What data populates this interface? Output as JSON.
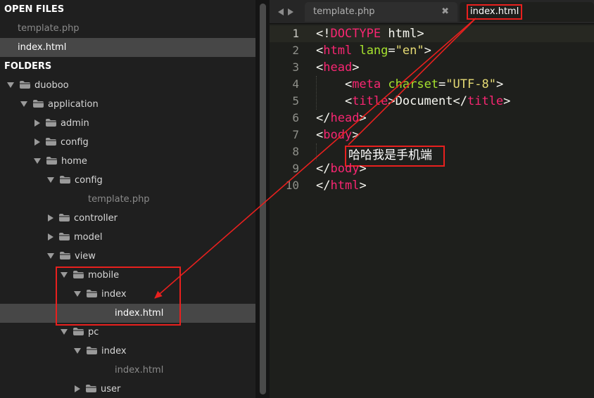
{
  "sidebar": {
    "open_files_header": "OPEN FILES",
    "open_files": [
      {
        "label": "template.php"
      },
      {
        "label": "index.html"
      }
    ],
    "folders_header": "FOLDERS",
    "tree": [
      {
        "label": "duoboo",
        "expanded": "down"
      },
      {
        "label": "application",
        "expanded": "down"
      },
      {
        "label": "admin",
        "expanded": "right"
      },
      {
        "label": "config",
        "expanded": "right"
      },
      {
        "label": "home",
        "expanded": "down"
      },
      {
        "label": "config",
        "expanded": "down"
      },
      {
        "label": "template.php",
        "type": "file"
      },
      {
        "label": "controller",
        "expanded": "right"
      },
      {
        "label": "model",
        "expanded": "right"
      },
      {
        "label": "view",
        "expanded": "down"
      },
      {
        "label": "mobile",
        "expanded": "down"
      },
      {
        "label": "index",
        "expanded": "down"
      },
      {
        "label": "index.html",
        "type": "file",
        "active": true
      },
      {
        "label": "pc",
        "expanded": "down"
      },
      {
        "label": "index",
        "expanded": "down"
      },
      {
        "label": "index.html",
        "type": "file"
      },
      {
        "label": "user",
        "expanded": "right"
      }
    ]
  },
  "tabs": [
    {
      "label": "template.php",
      "close": "✖"
    },
    {
      "label": "index.html"
    }
  ],
  "editor": {
    "line_numbers": [
      "1",
      "2",
      "3",
      "4",
      "5",
      "6",
      "7",
      "8",
      "9",
      "10"
    ],
    "chinese_text": "哈哈我是手机端"
  },
  "colors": {
    "annotation": "#e8201e",
    "tag": "#f92672",
    "attribute": "#a6e22e",
    "string": "#e6db74"
  }
}
